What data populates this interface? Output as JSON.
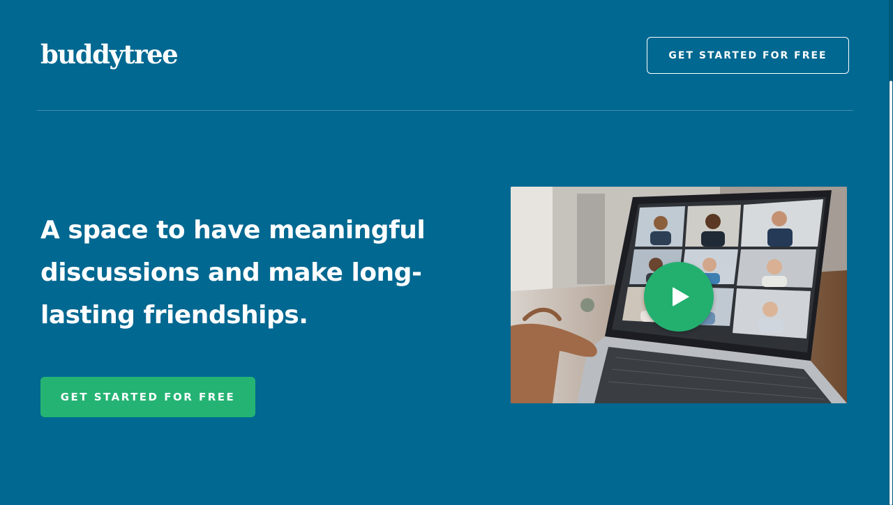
{
  "header": {
    "logo_text": "buddytree",
    "cta_label": "GET STARTED FOR FREE"
  },
  "hero": {
    "headline": "A space to have meaningful discussions and make long-lasting friendships.",
    "cta_label": "GET STARTED FOR FREE",
    "video": {
      "thumbnail_description_icon": "video-call-laptop-image",
      "play_icon": "play-icon"
    }
  },
  "colors": {
    "background": "#006891",
    "accent_green": "#25b373",
    "text": "#ffffff"
  }
}
